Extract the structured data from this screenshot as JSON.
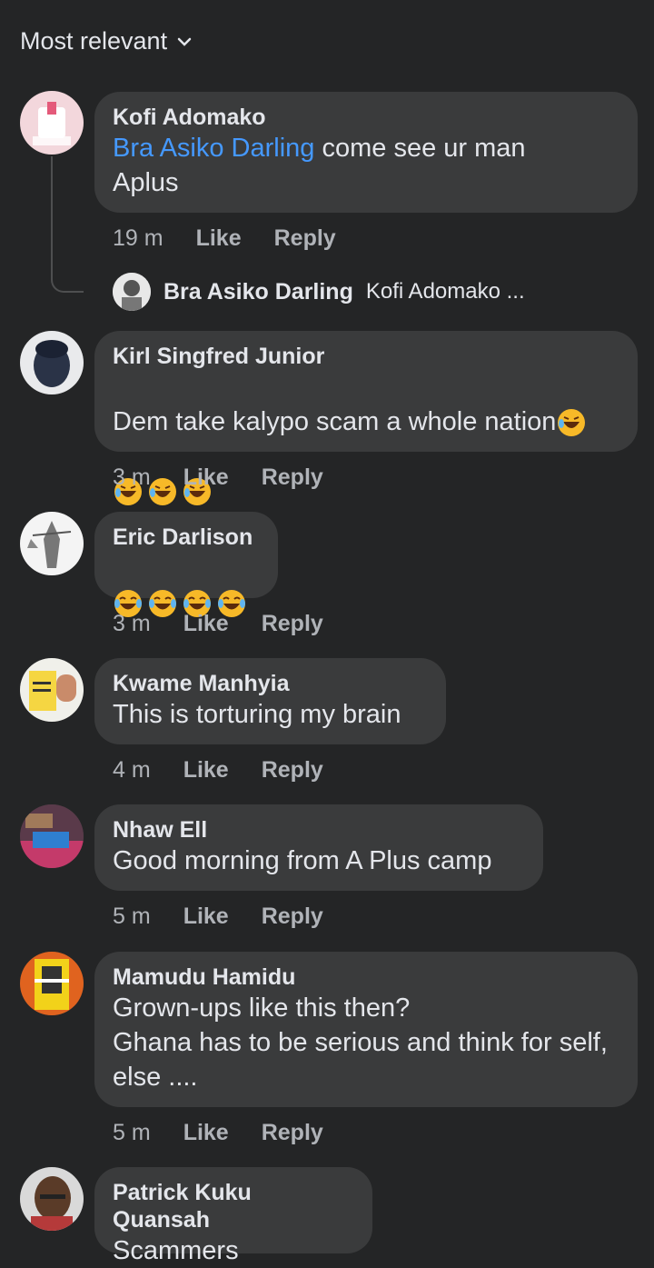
{
  "sort": {
    "label": "Most relevant"
  },
  "actions": {
    "like": "Like",
    "reply": "Reply"
  },
  "comments": [
    {
      "author": "Kofi Adomako",
      "mention": "Bra Asiko Darling",
      "text": " come see ur man\nAplus",
      "time": "19 m"
    },
    {
      "author": "Kirl Singfred Junior",
      "text": "Dem take kalypo scam a whole nation",
      "time": "3 m"
    },
    {
      "author": "Eric Darlison",
      "text": "",
      "time": "3 m"
    },
    {
      "author": "Kwame Manhyia",
      "text": "This is torturing my brain",
      "time": "4 m"
    },
    {
      "author": "Nhaw Ell",
      "text": "Good morning from A Plus camp",
      "time": "5 m"
    },
    {
      "author": "Mamudu Hamidu",
      "text": "Grown-ups like this then?\nGhana has to be serious and think for self, else ....",
      "time": "5 m"
    },
    {
      "author": "Patrick Kuku Quansah",
      "text": "Scammers"
    }
  ],
  "reply_preview": {
    "author": "Bra Asiko Darling",
    "snippet": "Kofi Adomako ..."
  },
  "emoji": {
    "rofl": "rolling-on-floor-laughing",
    "joy": "face-with-tears-of-joy"
  },
  "colors": {
    "background": "#242526",
    "bubble": "#3a3b3c",
    "mention": "#4599ff",
    "meta": "#b0b3b8"
  }
}
